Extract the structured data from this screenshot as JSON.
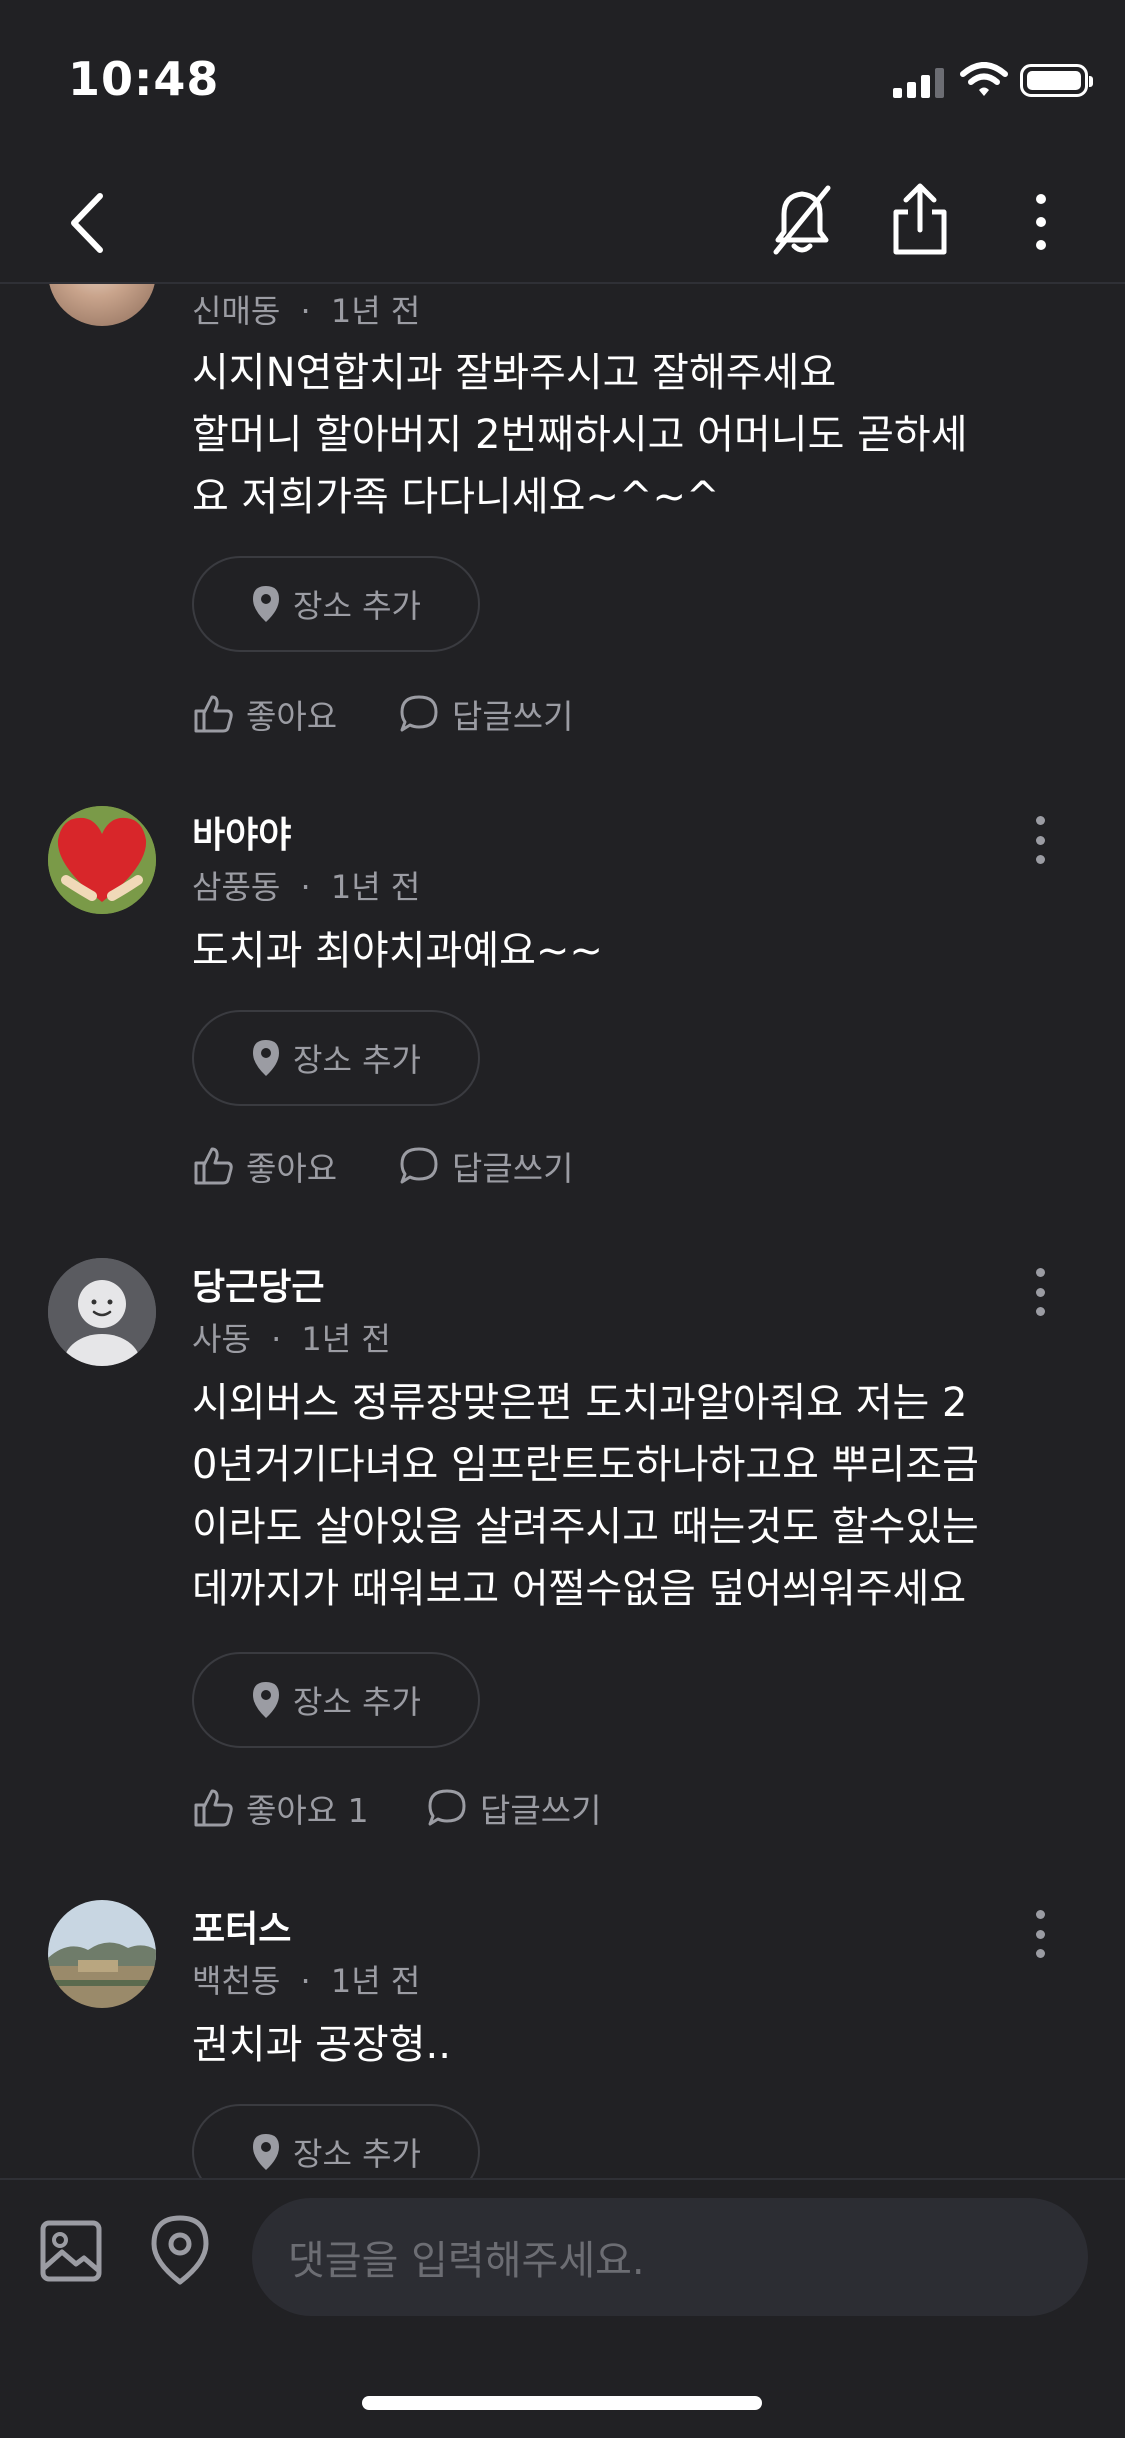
{
  "status_bar": {
    "time": "10:48"
  },
  "comments": [
    {
      "name": "",
      "location": "신매동",
      "time": "1년 전",
      "text": "시지N연합치과 잘봐주시고 잘해주세요\n할머니 할아버지 2번째하시고 어머니도 곧하세\n요 저희가족 다다니세요~^~^",
      "place_label": "장소 추가",
      "like_label": "좋아요",
      "reply_label": "답글쓰기"
    },
    {
      "name": "바야야",
      "location": "삼풍동",
      "time": "1년 전",
      "text": "도치과 최야치과예요~~",
      "place_label": "장소 추가",
      "like_label": "좋아요",
      "reply_label": "답글쓰기"
    },
    {
      "name": "당근당근",
      "location": "사동",
      "time": "1년 전",
      "text": "시외버스 정류장맞은편 도치과알아줘요 저는 2\n0년거기다녀요 임프란트도하나하고요 뿌리조금\n이라도 살아있음 살려주시고 때는것도 할수있는\n데까지가 때워보고 어쩔수없음 덮어씌워주세요",
      "place_label": "장소 추가",
      "like_label": "좋아요 1",
      "reply_label": "답글쓰기"
    },
    {
      "name": "포터스",
      "location": "백천동",
      "time": "1년 전",
      "text": "권치과 공장형..",
      "place_label": "장소 추가"
    }
  ],
  "meta_separator": "·",
  "input": {
    "placeholder": "댓글을 입력해주세요."
  },
  "icons": {
    "back": "chevron-left-icon",
    "mute": "bell-off-icon",
    "share": "share-icon",
    "more": "more-vertical-icon",
    "image": "image-icon",
    "location": "map-pin-icon",
    "like": "thumbs-up-icon",
    "reply": "speech-bubble-icon"
  },
  "colors": {
    "background": "#212124",
    "secondary_text": "#9b9ca3",
    "input_background": "#2c2d33"
  }
}
